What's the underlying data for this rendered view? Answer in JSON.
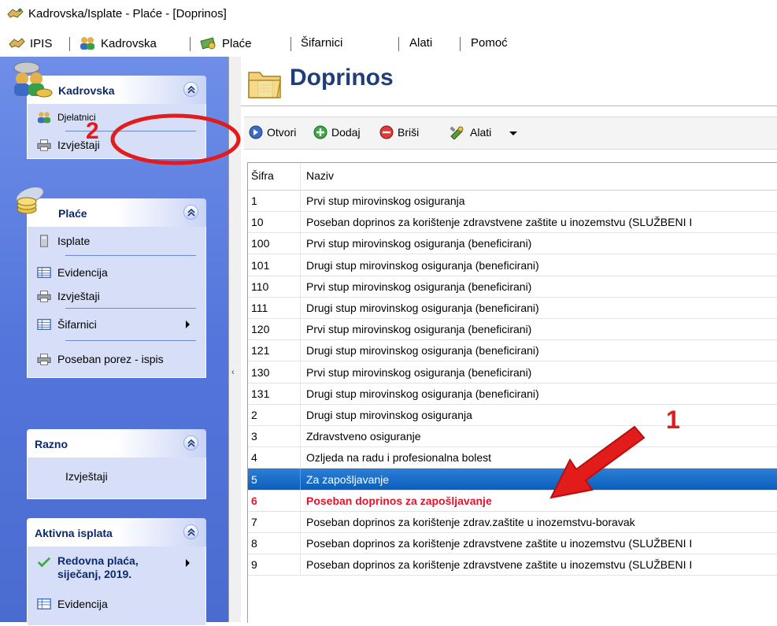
{
  "window": {
    "title": "Kadrovska/Isplate - Plaće - [Doprinos]"
  },
  "menu": {
    "items": [
      {
        "label": "IPIS",
        "icon": "handshake-icon"
      },
      {
        "label": "Kadrovska",
        "icon": "users-icon"
      },
      {
        "label": "Plaće",
        "icon": "money-icon"
      },
      {
        "label": "Šifarnici"
      },
      {
        "label": "Alati"
      },
      {
        "label": "Pomoć"
      }
    ]
  },
  "sidebar": {
    "panels": [
      {
        "title": "Kadrovska",
        "icon": "people-coins-icon",
        "items": [
          {
            "label": "Djelatnici",
            "icon": "users-icon"
          },
          {
            "label": "Izvještaji",
            "icon": "printer-icon"
          }
        ]
      },
      {
        "title": "Plaće",
        "icon": "coins-icon",
        "items": [
          {
            "label": "Isplate",
            "icon": "calculator-icon"
          },
          {
            "label": "Evidencija",
            "icon": "table-icon"
          },
          {
            "label": "Izvještaji",
            "icon": "printer-icon"
          },
          {
            "label": "Šifarnici",
            "icon": "table-icon"
          },
          {
            "label": "Poseban porez - ispis",
            "icon": "printer-icon"
          }
        ]
      },
      {
        "title": "Razno",
        "items": [
          {
            "label": "Izvještaji"
          }
        ]
      },
      {
        "title": "Aktivna isplata",
        "items": [
          {
            "label_line1": "Redovna plaća,",
            "label_line2": "siječanj, 2019.",
            "icon": "checkmark-icon"
          },
          {
            "label": "Evidencija",
            "icon": "table-icon"
          }
        ]
      }
    ]
  },
  "main": {
    "title": "Doprinos",
    "toolbar": {
      "open": "Otvori",
      "add": "Dodaj",
      "delete": "Briši",
      "tools": "Alati"
    },
    "grid": {
      "columns": [
        "Šifra",
        "Naziv"
      ],
      "rows": [
        {
          "code": "1",
          "name": "Prvi stup mirovinskog osiguranja"
        },
        {
          "code": "10",
          "name": "Poseban doprinos za korištenje zdravstvene zaštite u inozemstvu (SLUŽBENI I"
        },
        {
          "code": "100",
          "name": "Prvi stup mirovinskog osiguranja (beneficirani)"
        },
        {
          "code": "101",
          "name": "Drugi stup mirovinskog osiguranja (beneficirani)"
        },
        {
          "code": "110",
          "name": "Prvi stup mirovinskog osiguranja (beneficirani)"
        },
        {
          "code": "111",
          "name": "Drugi stup mirovinskog osiguranja (beneficirani)"
        },
        {
          "code": "120",
          "name": "Prvi stup mirovinskog osiguranja (beneficirani)"
        },
        {
          "code": "121",
          "name": "Drugi stup mirovinskog osiguranja (beneficirani)"
        },
        {
          "code": "130",
          "name": "Prvi stup mirovinskog osiguranja (beneficirani)"
        },
        {
          "code": "131",
          "name": "Drugi stup mirovinskog osiguranja (beneficirani)"
        },
        {
          "code": "2",
          "name": "Drugi stup mirovinskog osiguranja"
        },
        {
          "code": "3",
          "name": "Zdravstveno osiguranje"
        },
        {
          "code": "4",
          "name": "Ozljeda na radu i profesionalna bolest"
        },
        {
          "code": "5",
          "name": "Za zapošljavanje"
        },
        {
          "code": "6",
          "name": "Poseban doprinos za zapošljavanje"
        },
        {
          "code": "7",
          "name": "Poseban doprinos za korištenje zdrav.zaštite u inozemstvu-boravak"
        },
        {
          "code": "8",
          "name": "Poseban doprinos za korištenje zdravstvene zaštite u inozemstvu (SLUŽBENI I"
        },
        {
          "code": "9",
          "name": "Poseban doprinos za korištenje zdravstvene zaštite u inozemstvu (SLUŽBENI I"
        }
      ]
    }
  },
  "annotations": {
    "marker_1": "1",
    "marker_2": "2"
  },
  "colors": {
    "selected_row": "#0a5fbd",
    "highlight_text": "#e2142c",
    "annotation": "#e21b1b",
    "sidebar": "#5476dc"
  }
}
